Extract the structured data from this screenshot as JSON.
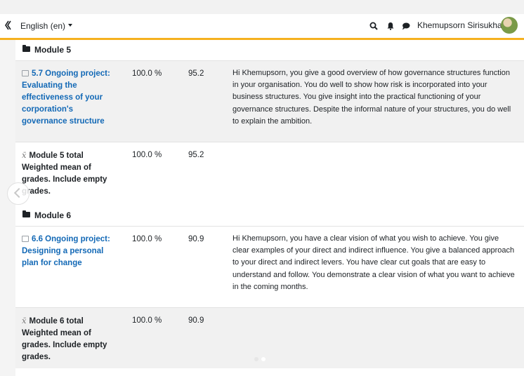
{
  "topbar": {
    "language": "English (en)",
    "user_name": "Khemupsorn Sirisukha"
  },
  "colors": {
    "accent": "#f5b11f",
    "link": "#1369b6",
    "text": "#1d2125"
  },
  "sections": [
    {
      "title": "Module 5",
      "item": {
        "title": "5.7 Ongoing project: Evaluating the effectiveness of your corporation's governance structure",
        "weight": "100.0 %",
        "grade": "95.2",
        "feedback": "Hi Khemupsorn, you give a good overview of how governance structures function in your organisation. You do well to show how risk is incorporated into your business structures. You give insight into the practical functioning of your governance structures. Despite the informal nature of your structures, you do well to explain the ambition."
      },
      "total": {
        "title": "Module 5 total",
        "subtitle": "Weighted mean of grades. Include empty grades.",
        "weight": "100.0 %",
        "grade": "95.2"
      }
    },
    {
      "title": "Module 6",
      "item": {
        "title": "6.6 Ongoing project: Designing a personal plan for change",
        "weight": "100.0 %",
        "grade": "90.9",
        "feedback": "Hi Khemupsorn, you have a clear vision of what you wish to achieve. You give clear examples of your direct and indirect influence. You give a balanced approach to your direct and indirect levers. You have clear cut goals that are easy to understand and follow. You demonstrate a clear vision of what you want to achieve in the coming months."
      },
      "total": {
        "title": "Module 6 total",
        "subtitle": "Weighted mean of grades. Include empty grades.",
        "weight": "100.0 %",
        "grade": "90.9"
      }
    }
  ]
}
